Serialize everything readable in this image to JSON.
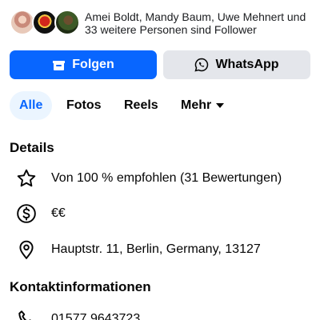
{
  "followers": {
    "names": "Amei Boldt, Mandy Baum, Uwe Mehnert",
    "connector": " und",
    "rest": "33 weitere Personen sind Follower"
  },
  "actions": {
    "follow_label": "Folgen",
    "whatsapp_label": "WhatsApp",
    "follow_color": "#0866ff"
  },
  "tabs": [
    {
      "label": "Alle",
      "active": true
    },
    {
      "label": "Fotos",
      "active": false
    },
    {
      "label": "Reels",
      "active": false
    },
    {
      "label": "Mehr",
      "active": false
    }
  ],
  "details": {
    "title": "Details",
    "items": [
      {
        "icon": "star-icon",
        "text": "Von 100 % empfohlen (31 Bewertungen)"
      },
      {
        "icon": "dollar-circle-icon",
        "text": "€€"
      },
      {
        "icon": "location-pin-icon",
        "text": "Hauptstr. 11, Berlin, Germany, 13127"
      }
    ]
  },
  "contact": {
    "title": "Kontaktinformationen",
    "items": [
      {
        "icon": "phone-icon",
        "text": "01577 9643723"
      }
    ]
  }
}
